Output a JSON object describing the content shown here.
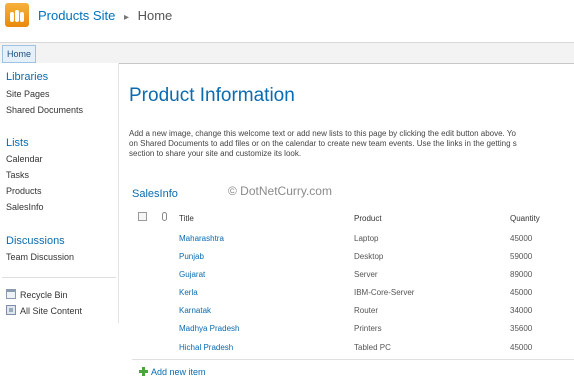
{
  "header": {
    "logo_icon": "sharepoint-site-icon",
    "site_title": "Products Site",
    "separator": "▸",
    "current_page": "Home"
  },
  "topnav": {
    "tabs": [
      {
        "label": "Home"
      }
    ]
  },
  "leftnav": {
    "libraries": {
      "heading": "Libraries",
      "items": [
        "Site Pages",
        "Shared Documents"
      ]
    },
    "lists": {
      "heading": "Lists",
      "items": [
        "Calendar",
        "Tasks",
        "Products",
        "SalesInfo"
      ]
    },
    "discussions": {
      "heading": "Discussions",
      "items": [
        "Team Discussion"
      ]
    },
    "recycle_bin": "Recycle Bin",
    "all_site_content": "All Site Content"
  },
  "main": {
    "title": "Product Information",
    "description": "Add a new image, change this welcome text or add new lists to this page by clicking the edit button above. Yo\non Shared Documents to add files or on the calendar to create new team events. Use the links in the getting s\nsection to share your site and customize its look.",
    "watermark": "© DotNetCurry.com",
    "list": {
      "title": "SalesInfo",
      "columns": {
        "title": "Title",
        "product": "Product",
        "quantity": "Quantity"
      },
      "rows": [
        {
          "title": "Maharashtra",
          "product": "Laptop",
          "quantity": "45000"
        },
        {
          "title": "Punjab",
          "product": "Desktop",
          "quantity": "59000"
        },
        {
          "title": "Gujarat",
          "product": "Server",
          "quantity": "89000"
        },
        {
          "title": "Kerla",
          "product": "IBM-Core-Server",
          "quantity": "45000"
        },
        {
          "title": "Karnatak",
          "product": "Router",
          "quantity": "34000"
        },
        {
          "title": "Madhya Pradesh",
          "product": "Printers",
          "quantity": "35600"
        },
        {
          "title": "Hichal Pradesh",
          "product": "Tabled PC",
          "quantity": "45000"
        }
      ],
      "add_new_item": "Add new item"
    }
  },
  "colors": {
    "accent": "#0a6bb0",
    "logo": "#f0a020",
    "add_icon": "#4aa53a"
  }
}
